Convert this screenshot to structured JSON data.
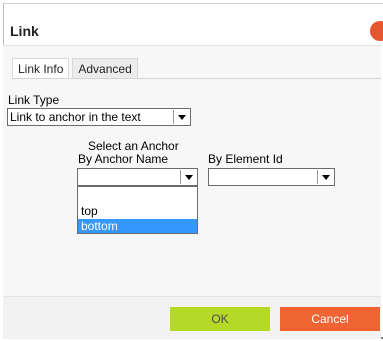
{
  "dialog": {
    "title": "Link",
    "close_icon": "close-icon",
    "close_color": "#e4572e"
  },
  "tabs": [
    {
      "label": "Link Info",
      "active": true
    },
    {
      "label": "Advanced",
      "active": false
    }
  ],
  "link_type": {
    "label": "Link Type",
    "value": "Link to anchor in the text"
  },
  "anchor": {
    "heading": "Select an Anchor",
    "by_name_label": "By Anchor Name",
    "by_name_value": "",
    "by_id_label": "By Element Id",
    "by_id_value": "",
    "dropdown_options": [
      {
        "label": "",
        "selected": false
      },
      {
        "label": "top",
        "selected": false
      },
      {
        "label": "bottom",
        "selected": true
      }
    ]
  },
  "buttons": {
    "ok": "OK",
    "cancel": "Cancel",
    "ok_color": "#b6d928",
    "cancel_color": "#f06434"
  },
  "selection_color": "#3399ff"
}
